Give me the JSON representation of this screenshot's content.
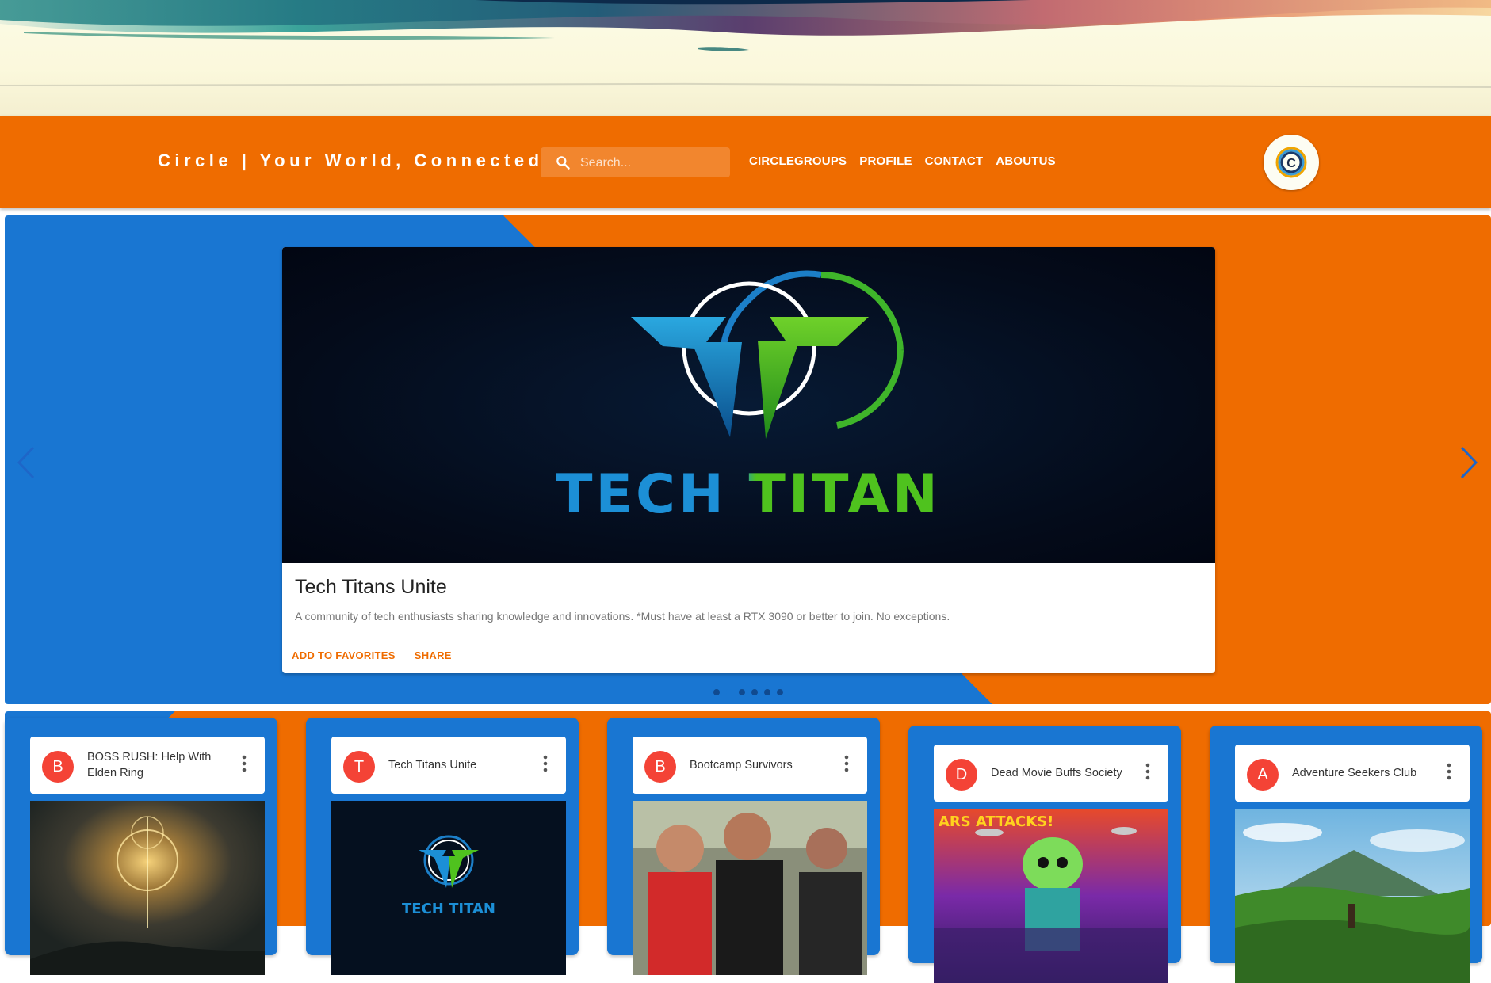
{
  "header": {
    "brand": "Circle | Your World, Connected",
    "search_placeholder": "Search...",
    "nav": [
      "CIRCLEGROUPS",
      "PROFILE",
      "CONTACT",
      "ABOUTUS"
    ],
    "logo_letter": "C"
  },
  "hero": {
    "title": "Tech Titans Unite",
    "description": "A community of tech enthusiasts sharing knowledge and innovations. *Must have at least a RTX 3090 or better to join. No exceptions.",
    "logo_text": "TECH TITAN",
    "actions": [
      "ADD TO FAVORITES",
      "SHARE"
    ],
    "slides_count": 6,
    "active_slide": 1
  },
  "groups": [
    {
      "letter": "B",
      "title": "BOSS RUSH: Help With Elden Ring"
    },
    {
      "letter": "T",
      "title": "Tech Titans Unite",
      "logo_text": "TECH TITAN"
    },
    {
      "letter": "B",
      "title": "Bootcamp Survivors"
    },
    {
      "letter": "D",
      "title": "Dead Movie Buffs Society",
      "poster_text": "ARS ATTACKS!"
    },
    {
      "letter": "A",
      "title": "Adventure Seekers Club"
    }
  ],
  "colors": {
    "primary_orange": "#ef6c00",
    "primary_blue": "#1976d2",
    "avatar_red": "#f44336"
  }
}
